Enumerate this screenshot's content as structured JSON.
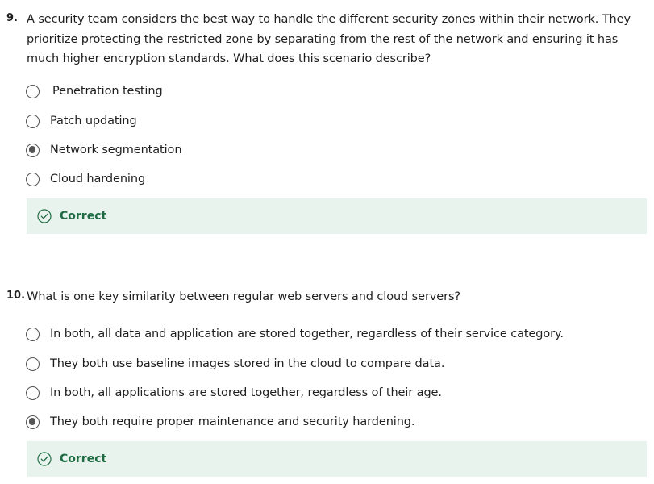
{
  "questions": [
    {
      "number": "9.",
      "text": "A security team considers the best way to handle the different security zones within their network. They prioritize protecting the restricted zone by separating from the rest of the network and ensuring it has much higher encryption standards. What does this scenario describe?",
      "options": [
        {
          "label": "Penetration testing",
          "selected": false
        },
        {
          "label": "Patch updating",
          "selected": false
        },
        {
          "label": "Network segmentation",
          "selected": true
        },
        {
          "label": "Cloud hardening",
          "selected": false
        }
      ],
      "feedback": "Correct"
    },
    {
      "number": "10.",
      "text": "What is one key similarity between regular web servers and cloud servers?",
      "options": [
        {
          "label": "In both, all data and application are stored together, regardless of their service category.",
          "selected": false
        },
        {
          "label": "They both use baseline images stored in the cloud to compare data.",
          "selected": false
        },
        {
          "label": "In both, all applications are stored together, regardless of their age.",
          "selected": false
        },
        {
          "label": "They both require proper maintenance and security hardening.",
          "selected": true
        }
      ],
      "feedback": "Correct"
    }
  ],
  "colors": {
    "feedback_bg": "#e8f3ee",
    "feedback_text": "#1f6b43",
    "radio_border": "#555555"
  }
}
